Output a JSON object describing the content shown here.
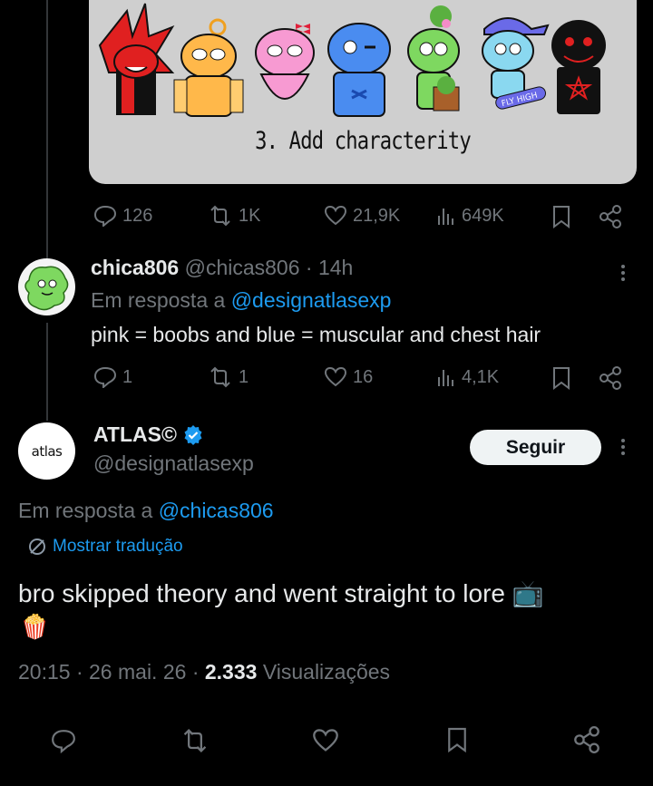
{
  "image_card": {
    "caption": "3. Add characterity",
    "skateboard_text": "FLY HIGH"
  },
  "tweet1_actions": {
    "replies": "126",
    "reposts": "1K",
    "likes": "21,9K",
    "views": "649K"
  },
  "reply": {
    "name": "chica806",
    "handle": "@chicas806",
    "sep": "·",
    "time": "14h",
    "replying_prefix": "Em resposta a",
    "replying_to": "@designatlasexp",
    "text": "pink = boobs and blue = muscular and chest hair",
    "actions": {
      "replies": "1",
      "reposts": "1",
      "likes": "16",
      "views": "4,1K"
    }
  },
  "main": {
    "avatar_text": "atlas",
    "name": "ATLAS©",
    "handle": "@designatlasexp",
    "follow_label": "Seguir",
    "replying_prefix": "Em resposta a",
    "replying_to": "@chicas806",
    "translate_label": "Mostrar tradução",
    "text": "bro skipped theory and went straight to lore",
    "emoji_tv": "📺",
    "emoji_popcorn": "🍿",
    "time": "20:15",
    "date": "26 mai. 26",
    "views_count": "2.333",
    "views_label": "Visualizações",
    "dot": "·"
  },
  "colors": {
    "link": "#1d9bf0",
    "muted": "#71767b",
    "verified": "#1d9bf0",
    "background": "#000000"
  }
}
